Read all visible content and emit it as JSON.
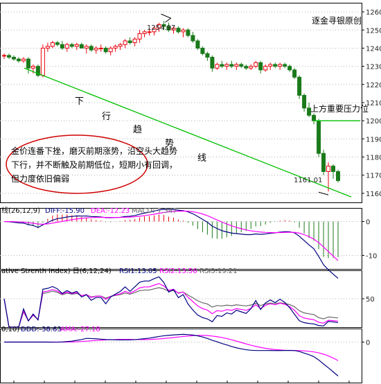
{
  "chart_data": {
    "type": "candlestick",
    "watermark": "逐金寻银原创",
    "price_axis": {
      "ylim": [
        1155,
        1265
      ],
      "ticks": [
        1160,
        1170,
        1180,
        1190,
        1200,
        1210,
        1220,
        1230,
        1240,
        1250,
        1260
      ]
    },
    "candles": [
      [
        1236,
        1237,
        1234,
        1236
      ],
      [
        1236,
        1237,
        1234,
        1235
      ],
      [
        1235,
        1236,
        1233,
        1234
      ],
      [
        1234,
        1235,
        1232,
        1233
      ],
      [
        1233,
        1235,
        1232,
        1234
      ],
      [
        1234,
        1235,
        1226,
        1229
      ],
      [
        1229,
        1231,
        1226,
        1230
      ],
      [
        1230,
        1231,
        1224,
        1225
      ],
      [
        1225,
        1242,
        1224,
        1240
      ],
      [
        1240,
        1243,
        1238,
        1241
      ],
      [
        1241,
        1244,
        1240,
        1243
      ],
      [
        1243,
        1244,
        1241,
        1242
      ],
      [
        1242,
        1244,
        1239,
        1240
      ],
      [
        1240,
        1243,
        1238,
        1242
      ],
      [
        1242,
        1243,
        1240,
        1241
      ],
      [
        1241,
        1243,
        1239,
        1242
      ],
      [
        1242,
        1243,
        1240,
        1240
      ],
      [
        1240,
        1242,
        1237,
        1241
      ],
      [
        1241,
        1242,
        1238,
        1239
      ],
      [
        1239,
        1241,
        1237,
        1240
      ],
      [
        1240,
        1242,
        1238,
        1240
      ],
      [
        1240,
        1241,
        1237,
        1238
      ],
      [
        1238,
        1241,
        1236,
        1240
      ],
      [
        1240,
        1242,
        1238,
        1241
      ],
      [
        1241,
        1243,
        1239,
        1242
      ],
      [
        1242,
        1245,
        1240,
        1244
      ],
      [
        1244,
        1246,
        1242,
        1243
      ],
      [
        1243,
        1246,
        1241,
        1245
      ],
      [
        1245,
        1250,
        1243,
        1248
      ],
      [
        1248,
        1250,
        1246,
        1249
      ],
      [
        1249,
        1251,
        1247,
        1249
      ],
      [
        1249,
        1252,
        1247,
        1251
      ],
      [
        1251,
        1254,
        1249,
        1253
      ],
      [
        1253,
        1255,
        1250,
        1252
      ],
      [
        1252,
        1254,
        1249,
        1250
      ],
      [
        1250,
        1252,
        1248,
        1251
      ],
      [
        1251,
        1252,
        1248,
        1249
      ],
      [
        1249,
        1251,
        1246,
        1250
      ],
      [
        1250,
        1251,
        1246,
        1247
      ],
      [
        1247,
        1249,
        1243,
        1244
      ],
      [
        1244,
        1245,
        1239,
        1240
      ],
      [
        1240,
        1241,
        1236,
        1237
      ],
      [
        1237,
        1238,
        1233,
        1235
      ],
      [
        1235,
        1236,
        1227,
        1229
      ],
      [
        1229,
        1232,
        1228,
        1231
      ],
      [
        1231,
        1233,
        1229,
        1230
      ],
      [
        1230,
        1232,
        1228,
        1231
      ],
      [
        1231,
        1233,
        1229,
        1230
      ],
      [
        1230,
        1232,
        1228,
        1231
      ],
      [
        1231,
        1232,
        1229,
        1230
      ],
      [
        1230,
        1231,
        1228,
        1229
      ],
      [
        1229,
        1231,
        1228,
        1230
      ],
      [
        1230,
        1233,
        1229,
        1232
      ],
      [
        1232,
        1233,
        1226,
        1228
      ],
      [
        1228,
        1231,
        1227,
        1230
      ],
      [
        1230,
        1232,
        1228,
        1231
      ],
      [
        1231,
        1232,
        1229,
        1230
      ],
      [
        1230,
        1232,
        1228,
        1231
      ],
      [
        1231,
        1232,
        1229,
        1230
      ],
      [
        1230,
        1231,
        1227,
        1228
      ],
      [
        1228,
        1229,
        1223,
        1224
      ],
      [
        1224,
        1225,
        1212,
        1214
      ],
      [
        1214,
        1215,
        1205,
        1207
      ],
      [
        1207,
        1210,
        1202,
        1203
      ],
      [
        1203,
        1204,
        1198,
        1200
      ],
      [
        1200,
        1201,
        1180,
        1182
      ],
      [
        1182,
        1184,
        1170,
        1172
      ],
      [
        1172,
        1177,
        1161,
        1175
      ],
      [
        1175,
        1176,
        1168,
        1172
      ],
      [
        1172,
        1173,
        1166,
        1167
      ]
    ],
    "trend_line": {
      "from_index": 1,
      "to_index": 70,
      "from_price": 1229,
      "to_price": 1158
    },
    "resistance_line": {
      "price": 1200,
      "from_index": 64,
      "to_index": 70
    },
    "marks": [
      {
        "label": "1254.97",
        "price": 1254.97,
        "index": 33
      },
      {
        "label": "1161.01",
        "price": 1161.01,
        "index": 67
      }
    ],
    "annotations": {
      "resistance": "上方重要压力位",
      "trend_chars": [
        "下",
        "行",
        "趋",
        "势",
        "线"
      ],
      "comment_lines": [
        "金价连番下挫，磨灭前期涨势，沿空头大趋势",
        "下行，并不断触及前期低位，短期小有回调，",
        "但力度依旧偏弱"
      ]
    },
    "macd": {
      "title": "线(26,12,9)",
      "legend": [
        {
          "text": "DIFF:-15.90",
          "color": "#000080"
        },
        {
          "text": "DEA:-12.23",
          "color": "#ff00ff"
        },
        {
          "text": "MACD:-7.347",
          "color": "#666666"
        }
      ],
      "ticks": [
        "0",
        "-10"
      ],
      "ylim": [
        -14,
        4
      ]
    },
    "rsi": {
      "title": "ative Strenth Index) 日(6,12,24)",
      "legend": [
        {
          "text": "RSI1:13.05",
          "color": "#000080"
        },
        {
          "text": "RSI2:13.56",
          "color": "#ff00ff"
        },
        {
          "text": "RSI3:19.21",
          "color": "#666666"
        }
      ],
      "ticks": [
        "50"
      ],
      "ylim": [
        0,
        100
      ]
    },
    "dma": {
      "title": "0,10)",
      "legend": [
        {
          "text": "DDD:-38.63",
          "color": "#000080"
        },
        {
          "text": "AMA:-27.18",
          "color": "#ff00ff"
        }
      ],
      "ticks": [
        "0"
      ],
      "ylim": [
        -45,
        15
      ]
    },
    "colors": {
      "up": "#e8000b",
      "down": "#1a7a1a",
      "trend": "#00c000",
      "ellipse": "#d00000",
      "grid": "#b0b0b0"
    }
  }
}
